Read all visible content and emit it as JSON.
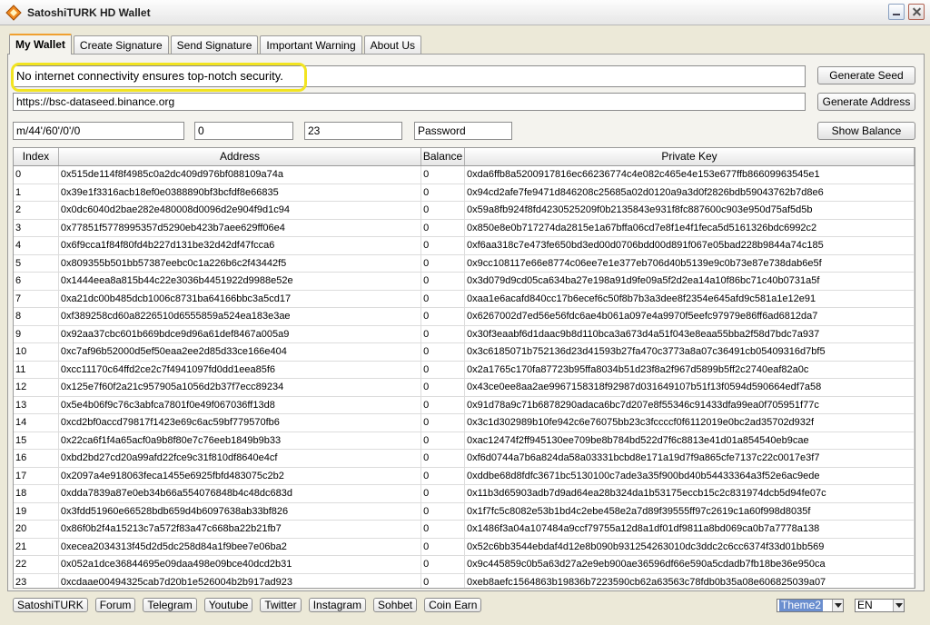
{
  "window": {
    "title": "SatoshiTURK HD Wallet"
  },
  "tabs": [
    "My Wallet",
    "Create Signature",
    "Send Signature",
    "Important Warning",
    "About Us"
  ],
  "inputs": {
    "seed": "No internet connectivity ensures top-notch security.",
    "rpc_url": "https://bsc-dataseed.binance.org",
    "derivation_path": "m/44'/60'/0'/0",
    "start_index": "0",
    "count": "23",
    "password": "Password"
  },
  "buttons": {
    "generate_seed": "Generate Seed",
    "generate_address": "Generate Address",
    "show_balance": "Show Balance"
  },
  "table": {
    "headers": [
      "Index",
      "Address",
      "Balance",
      "Private Key"
    ],
    "rows": [
      [
        "0",
        "0x515de114f8f4985c0a2dc409d976bf088109a74a",
        "0",
        "0xda6ffb8a5200917816ec66236774c4e082c465e4e153e677ffb86609963545e1"
      ],
      [
        "1",
        "0x39e1f3316acb18ef0e0388890bf3bcfdf8e66835",
        "0",
        "0x94cd2afe7fe9471d846208c25685a02d0120a9a3d0f2826bdb59043762b7d8e6"
      ],
      [
        "2",
        "0x0dc6040d2bae282e480008d0096d2e904f9d1c94",
        "0",
        "0x59a8fb924f8fd4230525209f0b2135843e931f8fc887600c903e950d75af5d5b"
      ],
      [
        "3",
        "0x77851f5778995357d5290eb423b7aee629ff06e4",
        "0",
        "0x850e8e0b717274da2815e1a67bffa06cd7e8f1e4f1feca5d5161326bdc6992c2"
      ],
      [
        "4",
        "0x6f9cca1f84f80fd4b227d131be32d42df47fcca6",
        "0",
        "0xf6aa318c7e473fe650bd3ed00d0706bdd00d891f067e05bad228b9844a74c185"
      ],
      [
        "5",
        "0x809355b501bb57387eebc0c1a226b6c2f43442f5",
        "0",
        "0x9cc108117e66e8774c06ee7e1e377eb706d40b5139e9c0b73e87e738dab6e5f"
      ],
      [
        "6",
        "0x1444eea8a815b44c22e3036b4451922d9988e52e",
        "0",
        "0x3d079d9cd05ca634ba27e198a91d9fe09a5f2d2ea14a10f86bc71c40b0731a5f"
      ],
      [
        "7",
        "0xa21dc00b485dcb1006c8731ba64166bbc3a5cd17",
        "0",
        "0xaa1e6acafd840cc17b6ecef6c50f8b7b3a3dee8f2354e645afd9c581a1e12e91"
      ],
      [
        "8",
        "0xf389258cd60a8226510d6555859a524ea183e3ae",
        "0",
        "0x6267002d7ed56e56fdc6ae4b061a097e4a9970f5eefc97979e86ff6ad6812da7"
      ],
      [
        "9",
        "0x92aa37cbc601b669bdce9d96a61def8467a005a9",
        "0",
        "0x30f3eaabf6d1daac9b8d110bca3a673d4a51f043e8eaa55bba2f58d7bdc7a937"
      ],
      [
        "10",
        "0xc7af96b52000d5ef50eaa2ee2d85d33ce166e404",
        "0",
        "0x3c6185071b752136d23d41593b27fa470c3773a8a07c36491cb05409316d7bf5"
      ],
      [
        "11",
        "0xcc11170c64ffd2ce2c7f4941097fd0dd1eea85f6",
        "0",
        "0x2a1765c170fa87723b95ffa8034b51d23f8a2f967d5899b5ff2c2740eaf82a0c"
      ],
      [
        "12",
        "0x125e7f60f2a21c957905a1056d2b37f7ecc89234",
        "0",
        "0x43ce0ee8aa2ae9967158318f92987d031649107b51f13f0594d590664edf7a58"
      ],
      [
        "13",
        "0x5e4b06f9c76c3abfca7801f0e49f067036ff13d8",
        "0",
        "0x91d78a9c71b6878290adaca6bc7d207e8f55346c91433dfa99ea0f705951f77c"
      ],
      [
        "14",
        "0xcd2bf0accd79817f1423e69c6ac59bf779570fb6",
        "0",
        "0x3c1d302989b10fe942c6e76075bb23c3fccccf0f6112019e0bc2ad35702d932f"
      ],
      [
        "15",
        "0x22ca6f1f4a65acf0a9b8f80e7c76eeb1849b9b33",
        "0",
        "0xac12474f2ff945130ee709be8b784bd522d7f6c8813e41d01a854540eb9cae"
      ],
      [
        "16",
        "0xbd2bd27cd20a99afd22fce9c31f810df8640e4cf",
        "0",
        "0xf6d0744a7b6a824da58a03331bcbd8e171a19d7f9a865cfe7137c22c0017e3f7"
      ],
      [
        "17",
        "0x2097a4e918063feca1455e6925fbfd483075c2b2",
        "0",
        "0xddbe68d8fdfc3671bc5130100c7ade3a35f900bd40b54433364a3f52e6ac9ede"
      ],
      [
        "18",
        "0xdda7839a87e0eb34b66a554076848b4c48dc683d",
        "0",
        "0x11b3d65903adb7d9ad64ea28b324da1b53175eccb15c2c831974dcb5d94fe07c"
      ],
      [
        "19",
        "0x3fdd51960e66528bdb659d4b6097638ab33bf826",
        "0",
        "0x1f7fc5c8082e53b1bd4c2ebe458e2a7d89f39555ff97c2619c1a60f998d8035f"
      ],
      [
        "20",
        "0x86f0b2f4a15213c7a572f83a47c668ba22b21fb7",
        "0",
        "0x1486f3a04a107484a9ccf79755a12d8a1df01df9811a8bd069ca0b7a7778a138"
      ],
      [
        "21",
        "0xecea2034313f45d2d5dc258d84a1f9bee7e06ba2",
        "0",
        "0x52c6bb3544ebdaf4d12e8b090b931254263010dc3ddc2c6cc6374f33d01bb569"
      ],
      [
        "22",
        "0x052a1dce36844695e09daa498e09bce40dcd2b31",
        "0",
        "0x9c445859c0b5a63d27a2e9eb900ae36596df66e590a5cdadb7fb18be36e950ca"
      ],
      [
        "23",
        "0xcdaae00494325cab7d20b1e526004b2b917ad923",
        "0",
        "0xeb8aefc1564863b19836b7223590cb62a63563c78fdb0b35a08e606825039a07"
      ]
    ]
  },
  "footer": {
    "links": [
      "SatoshiTURK",
      "Forum",
      "Telegram",
      "Youtube",
      "Twitter",
      "Instagram",
      "Sohbet",
      "Coin Earn"
    ],
    "theme": "Theme2",
    "language": "EN"
  },
  "colors": {
    "highlight": "#f2e420",
    "active_tab_accent": "#f0a030",
    "theme_select": "#6a8ecf"
  }
}
